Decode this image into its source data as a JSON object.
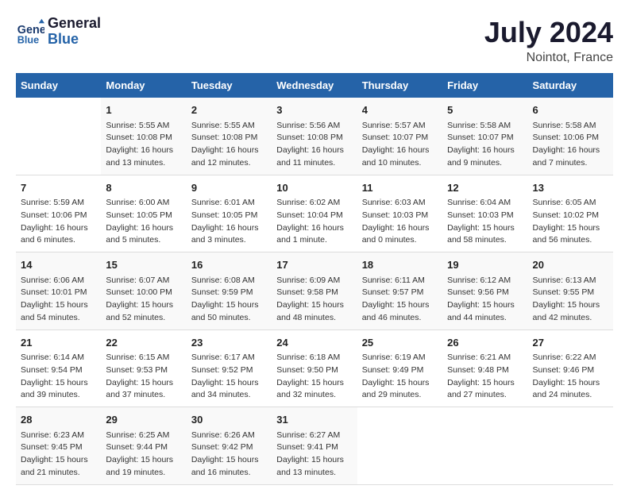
{
  "header": {
    "logo_line1": "General",
    "logo_line2": "Blue",
    "title": "July 2024",
    "subtitle": "Nointot, France"
  },
  "weekdays": [
    "Sunday",
    "Monday",
    "Tuesday",
    "Wednesday",
    "Thursday",
    "Friday",
    "Saturday"
  ],
  "weeks": [
    [
      {
        "day": "",
        "info": ""
      },
      {
        "day": "1",
        "info": "Sunrise: 5:55 AM\nSunset: 10:08 PM\nDaylight: 16 hours\nand 13 minutes."
      },
      {
        "day": "2",
        "info": "Sunrise: 5:55 AM\nSunset: 10:08 PM\nDaylight: 16 hours\nand 12 minutes."
      },
      {
        "day": "3",
        "info": "Sunrise: 5:56 AM\nSunset: 10:08 PM\nDaylight: 16 hours\nand 11 minutes."
      },
      {
        "day": "4",
        "info": "Sunrise: 5:57 AM\nSunset: 10:07 PM\nDaylight: 16 hours\nand 10 minutes."
      },
      {
        "day": "5",
        "info": "Sunrise: 5:58 AM\nSunset: 10:07 PM\nDaylight: 16 hours\nand 9 minutes."
      },
      {
        "day": "6",
        "info": "Sunrise: 5:58 AM\nSunset: 10:06 PM\nDaylight: 16 hours\nand 7 minutes."
      }
    ],
    [
      {
        "day": "7",
        "info": "Sunrise: 5:59 AM\nSunset: 10:06 PM\nDaylight: 16 hours\nand 6 minutes."
      },
      {
        "day": "8",
        "info": "Sunrise: 6:00 AM\nSunset: 10:05 PM\nDaylight: 16 hours\nand 5 minutes."
      },
      {
        "day": "9",
        "info": "Sunrise: 6:01 AM\nSunset: 10:05 PM\nDaylight: 16 hours\nand 3 minutes."
      },
      {
        "day": "10",
        "info": "Sunrise: 6:02 AM\nSunset: 10:04 PM\nDaylight: 16 hours\nand 1 minute."
      },
      {
        "day": "11",
        "info": "Sunrise: 6:03 AM\nSunset: 10:03 PM\nDaylight: 16 hours\nand 0 minutes."
      },
      {
        "day": "12",
        "info": "Sunrise: 6:04 AM\nSunset: 10:03 PM\nDaylight: 15 hours\nand 58 minutes."
      },
      {
        "day": "13",
        "info": "Sunrise: 6:05 AM\nSunset: 10:02 PM\nDaylight: 15 hours\nand 56 minutes."
      }
    ],
    [
      {
        "day": "14",
        "info": "Sunrise: 6:06 AM\nSunset: 10:01 PM\nDaylight: 15 hours\nand 54 minutes."
      },
      {
        "day": "15",
        "info": "Sunrise: 6:07 AM\nSunset: 10:00 PM\nDaylight: 15 hours\nand 52 minutes."
      },
      {
        "day": "16",
        "info": "Sunrise: 6:08 AM\nSunset: 9:59 PM\nDaylight: 15 hours\nand 50 minutes."
      },
      {
        "day": "17",
        "info": "Sunrise: 6:09 AM\nSunset: 9:58 PM\nDaylight: 15 hours\nand 48 minutes."
      },
      {
        "day": "18",
        "info": "Sunrise: 6:11 AM\nSunset: 9:57 PM\nDaylight: 15 hours\nand 46 minutes."
      },
      {
        "day": "19",
        "info": "Sunrise: 6:12 AM\nSunset: 9:56 PM\nDaylight: 15 hours\nand 44 minutes."
      },
      {
        "day": "20",
        "info": "Sunrise: 6:13 AM\nSunset: 9:55 PM\nDaylight: 15 hours\nand 42 minutes."
      }
    ],
    [
      {
        "day": "21",
        "info": "Sunrise: 6:14 AM\nSunset: 9:54 PM\nDaylight: 15 hours\nand 39 minutes."
      },
      {
        "day": "22",
        "info": "Sunrise: 6:15 AM\nSunset: 9:53 PM\nDaylight: 15 hours\nand 37 minutes."
      },
      {
        "day": "23",
        "info": "Sunrise: 6:17 AM\nSunset: 9:52 PM\nDaylight: 15 hours\nand 34 minutes."
      },
      {
        "day": "24",
        "info": "Sunrise: 6:18 AM\nSunset: 9:50 PM\nDaylight: 15 hours\nand 32 minutes."
      },
      {
        "day": "25",
        "info": "Sunrise: 6:19 AM\nSunset: 9:49 PM\nDaylight: 15 hours\nand 29 minutes."
      },
      {
        "day": "26",
        "info": "Sunrise: 6:21 AM\nSunset: 9:48 PM\nDaylight: 15 hours\nand 27 minutes."
      },
      {
        "day": "27",
        "info": "Sunrise: 6:22 AM\nSunset: 9:46 PM\nDaylight: 15 hours\nand 24 minutes."
      }
    ],
    [
      {
        "day": "28",
        "info": "Sunrise: 6:23 AM\nSunset: 9:45 PM\nDaylight: 15 hours\nand 21 minutes."
      },
      {
        "day": "29",
        "info": "Sunrise: 6:25 AM\nSunset: 9:44 PM\nDaylight: 15 hours\nand 19 minutes."
      },
      {
        "day": "30",
        "info": "Sunrise: 6:26 AM\nSunset: 9:42 PM\nDaylight: 15 hours\nand 16 minutes."
      },
      {
        "day": "31",
        "info": "Sunrise: 6:27 AM\nSunset: 9:41 PM\nDaylight: 15 hours\nand 13 minutes."
      },
      {
        "day": "",
        "info": ""
      },
      {
        "day": "",
        "info": ""
      },
      {
        "day": "",
        "info": ""
      }
    ]
  ]
}
